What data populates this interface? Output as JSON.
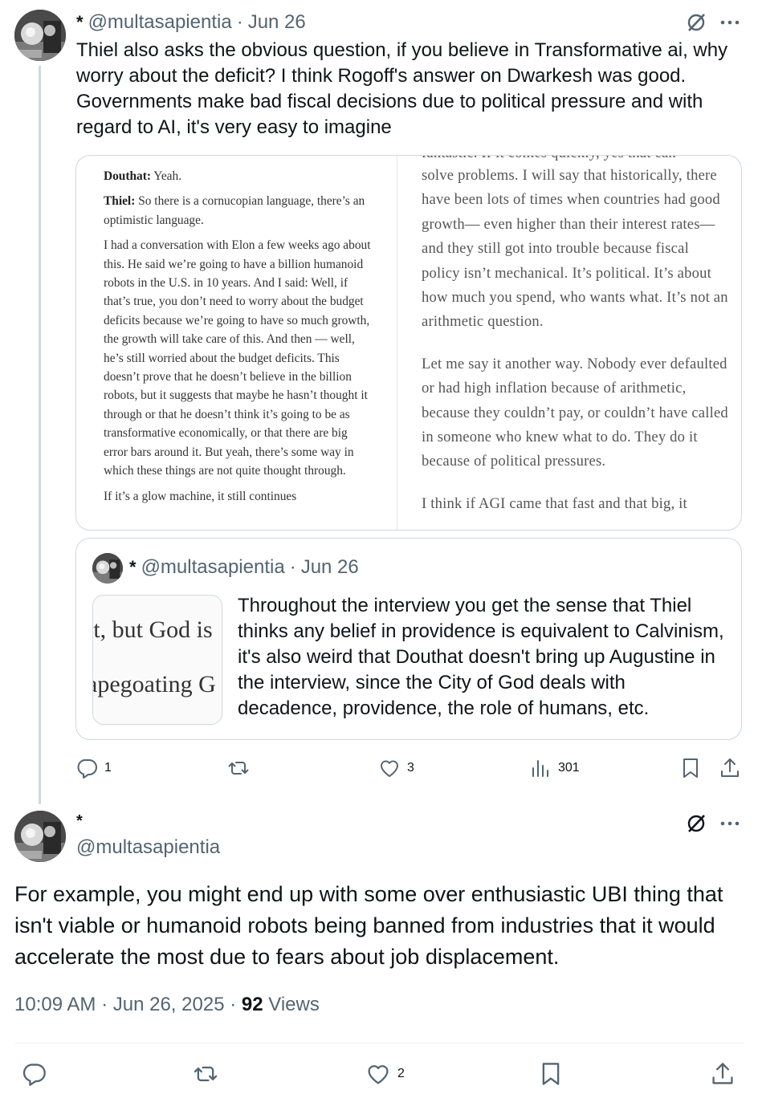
{
  "tweet1": {
    "display_name": "*",
    "handle": "@multasapientia",
    "date": "Jun 26",
    "separator": "·",
    "body": "Thiel also asks the obvious question, if you believe in Transformative ai, why worry about the deficit? I think Rogoff's answer on Dwarkesh was good. Governments make bad  fiscal decisions due to political pressure and with regard to AI, it's very easy to imagine",
    "media": {
      "left_column": {
        "p1_speaker": "Douthat:",
        "p1_text": " Yeah.",
        "p2_speaker": "Thiel:",
        "p2_text": " So there is a cornucopian language, there’s an optimistic language.",
        "p3_text": "I had a conversation with Elon a few weeks ago about this. He said we’re going to have a billion humanoid robots in the U.S. in 10 years. And I said: Well, if that’s true, you don’t need to worry about the budget deficits because we’re going to have so much growth, the growth will take care of this. And then — well, he’s still worried about the budget deficits. This doesn’t prove that he doesn’t believe in the billion robots, but it suggests that maybe he hasn’t thought it through or that he doesn’t think it’s going to be as transformative economically, or that there are big error bars around it. But yeah, there’s some way in which these things are not quite thought through.",
        "p4_cut": "If it’s a glow machine, it still continues"
      },
      "right_column": {
        "cut_top": "fantastic. If it comes quickly, yes that can",
        "p1": "solve problems. I will say that historically, there have been lots of times when countries had good growth— even higher than their interest rates—and they still got into trouble because fiscal policy isn’t mechanical. It’s political. It’s about how much you spend, who wants what. It’s not an arithmetic question.",
        "p2": "Let me say it another way. Nobody ever defaulted or had high inflation because of arithmetic, because they couldn’t pay, or couldn’t have called in someone who knew what to do. They do it because of political pressures.",
        "cut_bottom": "I think if AGI came that fast and that big, it"
      }
    },
    "quote": {
      "display_name": "*",
      "handle": "@multasapientia",
      "date": "Jun 26",
      "separator": "·",
      "thumb_line1": "it, but God is",
      "thumb_line2": "apegoating G",
      "body": "Throughout the interview you get the sense that Thiel thinks any belief in providence is equivalent to Calvinism, it's also weird that Douthat doesn't bring up Augustine in the interview, since the City of God deals with decadence, providence, the role of humans, etc."
    },
    "actions": {
      "replies": "1",
      "reposts": "",
      "likes": "3",
      "views": "301"
    }
  },
  "tweet2": {
    "display_name": "*",
    "handle": "@multasapientia",
    "body": "For example, you might end up with some over enthusiastic UBI thing that isn't viable or humanoid robots being banned from industries that it would accelerate the most due to fears about job displacement.",
    "time": "10:09 AM",
    "date": "Jun 26, 2025",
    "separator": "·",
    "views_count": "92",
    "views_label": "Views",
    "actions": {
      "replies": "",
      "reposts": "",
      "likes": "2"
    }
  },
  "colors": {
    "text_primary": "#0f1419",
    "text_secondary": "#536471",
    "border": "#cfd9de",
    "thread_line": "#cfd9de"
  },
  "icons": [
    "reply-icon",
    "repost-icon",
    "like-icon",
    "views-icon",
    "bookmark-icon",
    "share-icon",
    "grok-icon",
    "more-icon"
  ]
}
